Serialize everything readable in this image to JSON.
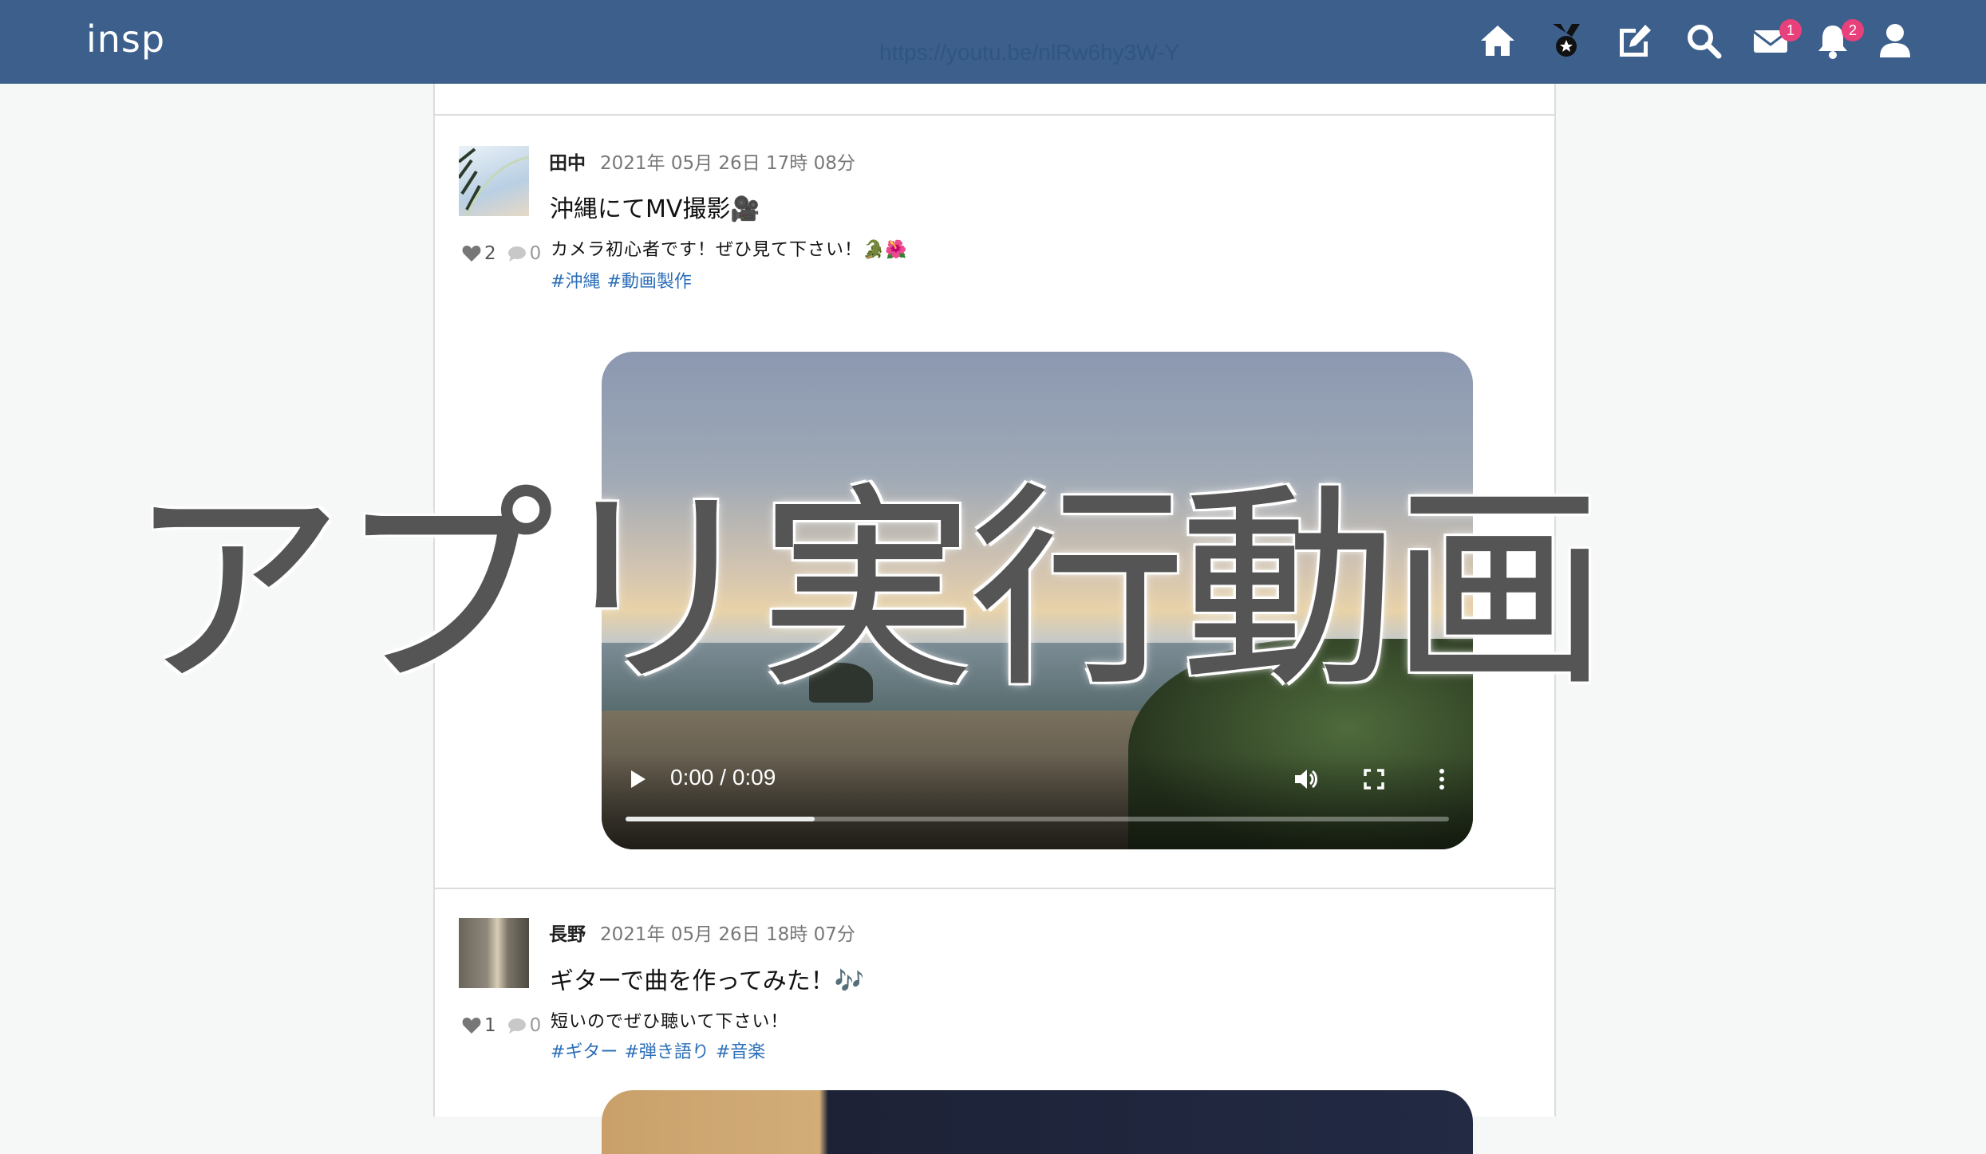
{
  "header": {
    "logo": "insp",
    "url_text": "https://youtu.be/nlRw6hy3W-Y",
    "nav": {
      "home_icon": "home-icon",
      "ranking_icon": "medal-icon",
      "post_icon": "edit-icon",
      "search_icon": "search-icon",
      "messages_icon": "envelope-icon",
      "messages_badge": "1",
      "notifications_icon": "bell-icon",
      "notifications_badge": "2",
      "profile_icon": "user-icon"
    }
  },
  "posts": [
    {
      "user": "田中",
      "date": "2021年 05月 26日 17時 08分",
      "title": "沖縄にてMV撮影🎥",
      "body": "カメラ初心者です！ぜひ見て下さい！🐊🌺",
      "tags": [
        "#沖縄",
        "#動画製作"
      ],
      "likes": "2",
      "comments": "0",
      "video": {
        "time": "0:00 / 0:09",
        "progress": 0.23
      }
    },
    {
      "user": "長野",
      "date": "2021年 05月 26日 18時 07分",
      "title": "ギターで曲を作ってみた！🎶",
      "body": "短いのでぜひ聴いて下さい！",
      "tags": [
        "#ギター",
        "#弾き語り",
        "#音楽"
      ],
      "likes": "1",
      "comments": "0"
    }
  ],
  "overlay": {
    "caption": "アプリ実行動画"
  },
  "colors": {
    "header_bg": "#3c5f8c",
    "tag_link": "#2d6fb8",
    "badge": "#e8407a"
  }
}
